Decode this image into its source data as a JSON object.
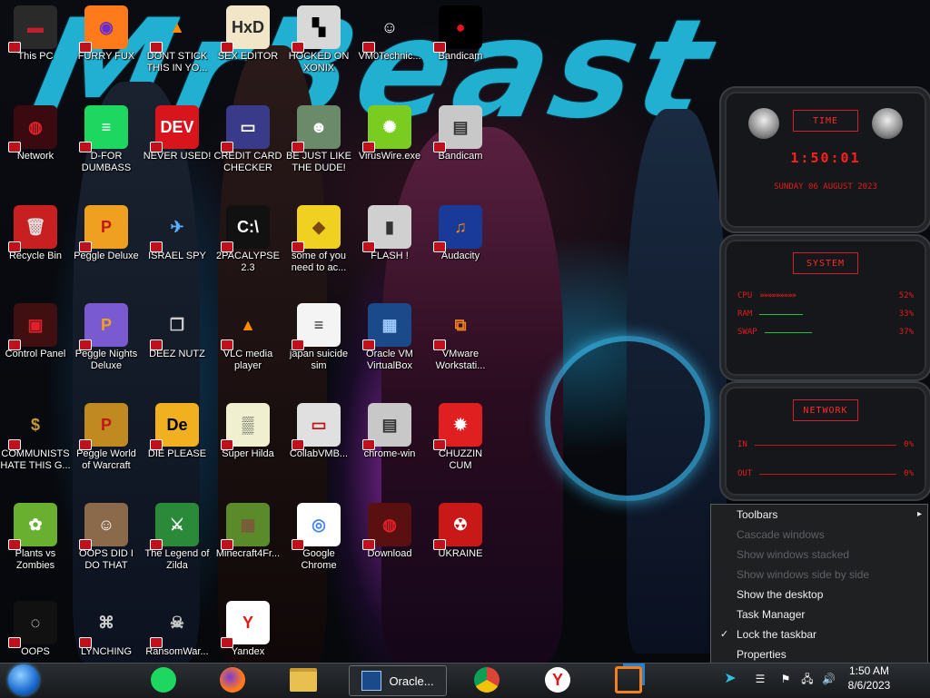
{
  "wallpaper": {
    "brand_text": "MrBeast"
  },
  "desktop_icons": [
    {
      "label": "This PC",
      "icon": "computer-icon",
      "bg": "#2a2a2a",
      "fg": "#c0202a",
      "glyph": "▬"
    },
    {
      "label": "FURRY FUX",
      "icon": "firefox-icon",
      "bg": "#ff7a1a",
      "fg": "#6a2cc8",
      "glyph": "◉"
    },
    {
      "label": "DONT STICK\nTHIS IN YO...",
      "icon": "vlc-cone-icon",
      "bg": "transparent",
      "fg": "#ff8c00",
      "glyph": "▲"
    },
    {
      "label": "SEX EDITOR",
      "icon": "hxd-icon",
      "bg": "#f2e6c8",
      "fg": "#2a2a2a",
      "glyph": "HxD"
    },
    {
      "label": "HOCKED ON\nXONIX",
      "icon": "xonix-icon",
      "bg": "#d8d8d8",
      "fg": "#000",
      "glyph": "▚"
    },
    {
      "label": "VM0Technic...",
      "icon": "doctor-icon",
      "bg": "transparent",
      "fg": "#fff",
      "glyph": "☺"
    },
    {
      "label": "Bandicam",
      "icon": "bandicam-record-icon",
      "bg": "#000",
      "fg": "#e3141c",
      "glyph": "●"
    },
    {
      "label": "Network",
      "icon": "network-icon",
      "bg": "#3a0a10",
      "fg": "#e0202a",
      "glyph": "◍"
    },
    {
      "label": "D-FOR\nDUMBASS",
      "icon": "spotify-icon",
      "bg": "#1ed760",
      "fg": "#fff",
      "glyph": "≡"
    },
    {
      "label": "NEVER USED!",
      "icon": "devcpp-icon",
      "bg": "#d8141c",
      "fg": "#fff",
      "glyph": "DEV"
    },
    {
      "label": "CREDIT CARD\nCHECKER",
      "icon": "credit-card-icon",
      "bg": "#3a3a8a",
      "fg": "#fff",
      "glyph": "▭"
    },
    {
      "label": "BE JUST LIKE\nTHE DUDE!",
      "icon": "dude-avatar-icon",
      "bg": "#6a8a6a",
      "fg": "#fff",
      "glyph": "☻"
    },
    {
      "label": "VirusWire.exe",
      "icon": "lime-icon",
      "bg": "#7acc20",
      "fg": "#fff",
      "glyph": "✺"
    },
    {
      "label": "Bandicam",
      "icon": "bandicam-folder-icon",
      "bg": "#c8c8c8",
      "fg": "#333",
      "glyph": "▤"
    },
    {
      "label": "Recycle Bin",
      "icon": "recycle-bin-icon",
      "bg": "#c82020",
      "fg": "#ddd",
      "glyph": "🗑"
    },
    {
      "label": "Peggle Deluxe",
      "icon": "peggle-icon",
      "bg": "#f0a020",
      "fg": "#c01818",
      "glyph": "P"
    },
    {
      "label": "ISRAEL SPY",
      "icon": "spy-tool-icon",
      "bg": "transparent",
      "fg": "#5ab0ff",
      "glyph": "✈"
    },
    {
      "label": "2PACALYPSE\n2.3",
      "icon": "terminal-icon",
      "bg": "#111",
      "fg": "#fff",
      "glyph": "C:\\"
    },
    {
      "label": "some of you\nneed to ac...",
      "icon": "beaver-icon",
      "bg": "#f0d020",
      "fg": "#7a4a10",
      "glyph": "◆"
    },
    {
      "label": "FLASH !",
      "icon": "flash-drive-icon",
      "bg": "#d0d0d0",
      "fg": "#333",
      "glyph": "▮"
    },
    {
      "label": "Audacity",
      "icon": "audacity-icon",
      "bg": "#1a3a9a",
      "fg": "#ff8800",
      "glyph": "♫"
    },
    {
      "label": "Control Panel",
      "icon": "control-panel-icon",
      "bg": "#401010",
      "fg": "#e0202a",
      "glyph": "▣"
    },
    {
      "label": "Peggle Nights\nDeluxe",
      "icon": "peggle-nights-icon",
      "bg": "#7a5ad0",
      "fg": "#f0a020",
      "glyph": "P"
    },
    {
      "label": "DEEZ NUTZ",
      "icon": "stacked-windows-icon",
      "bg": "transparent",
      "fg": "#ccc",
      "glyph": "❒"
    },
    {
      "label": "VLC media\nplayer",
      "icon": "vlc-icon",
      "bg": "transparent",
      "fg": "#ff8c00",
      "glyph": "▲"
    },
    {
      "label": "japan suicide\nsim",
      "icon": "document-icon",
      "bg": "#f4f4f4",
      "fg": "#333",
      "glyph": "≡"
    },
    {
      "label": "Oracle VM\nVirtualBox",
      "icon": "virtualbox-icon",
      "bg": "#1b4a8a",
      "fg": "#9ecbff",
      "glyph": "▦"
    },
    {
      "label": "VMware\nWorkstati...",
      "icon": "vmware-icon",
      "bg": "transparent",
      "fg": "#f08020",
      "glyph": "⧉"
    },
    {
      "label": "COMMUNISTS\nHATE THIS G...",
      "icon": "money-bag-icon",
      "bg": "transparent",
      "fg": "#c89a3a",
      "glyph": "$"
    },
    {
      "label": "Peggle World\nof Warcraft",
      "icon": "peggle-wow-icon",
      "bg": "#c08a20",
      "fg": "#c01818",
      "glyph": "P"
    },
    {
      "label": "DIE PLEASE",
      "icon": "die-icon",
      "bg": "#f0b020",
      "fg": "#000",
      "glyph": "De"
    },
    {
      "label": "Super Hilda",
      "icon": "pixel-hilda-icon",
      "bg": "#f0f0d0",
      "fg": "#333",
      "glyph": "▒"
    },
    {
      "label": "CollabVMB...",
      "icon": "monitor-icon",
      "bg": "#e0e0e0",
      "fg": "#c01818",
      "glyph": "▭"
    },
    {
      "label": "chrome-win",
      "icon": "folder-icon",
      "bg": "#c8c8c8",
      "fg": "#333",
      "glyph": "▤"
    },
    {
      "label": "CHUZZIN\nCUM",
      "icon": "chuzzle-icon",
      "bg": "#e02020",
      "fg": "#fff",
      "glyph": "✹"
    },
    {
      "label": "Plants vs\nZombies",
      "icon": "pvz-icon",
      "bg": "#6ab030",
      "fg": "#fff",
      "glyph": "✿"
    },
    {
      "label": "OOPS DID I\nDO THAT",
      "icon": "portrait-icon",
      "bg": "#8a6a4a",
      "fg": "#fff",
      "glyph": "☺"
    },
    {
      "label": "The Legend of\nZilda",
      "icon": "zilda-sprite-icon",
      "bg": "#2a8a3a",
      "fg": "#fff",
      "glyph": "⚔"
    },
    {
      "label": "Minecraft4Fr...",
      "icon": "minecraft-block-icon",
      "bg": "#5a8a2a",
      "fg": "#7a5a3a",
      "glyph": "▦"
    },
    {
      "label": "Google\nChrome",
      "icon": "chrome-icon",
      "bg": "#ffffff",
      "fg": "#4285f4",
      "glyph": "◎"
    },
    {
      "label": "Download",
      "icon": "download-icon",
      "bg": "#5a1010",
      "fg": "#e0202a",
      "glyph": "◍"
    },
    {
      "label": "UKRAINE",
      "icon": "radiation-icon",
      "bg": "#c81818",
      "fg": "#fff",
      "glyph": "☢"
    },
    {
      "label": "OOPS",
      "icon": "oops-icon",
      "bg": "#111",
      "fg": "#fff",
      "glyph": "◌"
    },
    {
      "label": "LYNCHING",
      "icon": "rope-icon",
      "bg": "transparent",
      "fg": "#ccc",
      "glyph": "⌘"
    },
    {
      "label": "RansomWar...",
      "icon": "skull-icon",
      "bg": "transparent",
      "fg": "#ccc",
      "glyph": "☠"
    },
    {
      "label": "Yandex",
      "icon": "yandex-icon",
      "bg": "#ffffff",
      "fg": "#e01818",
      "glyph": "Y"
    }
  ],
  "widgets": {
    "time": {
      "title": "TIME",
      "clock": "1:50:01",
      "date": "SUNDAY 06 AUGUST 2023"
    },
    "system": {
      "title": "SYSTEM",
      "rows": [
        {
          "label": "CPU",
          "value": "52%",
          "level": 0.52
        },
        {
          "label": "RAM",
          "value": "33%",
          "level": 0.33
        },
        {
          "label": "SWAP",
          "value": "37%",
          "level": 0.37
        }
      ]
    },
    "network": {
      "title": "NETWORK",
      "rows": [
        {
          "label": "IN",
          "value": "0%"
        },
        {
          "label": "OUT",
          "value": "0%"
        }
      ]
    }
  },
  "context_menu": {
    "items": [
      {
        "label": "Toolbars",
        "enabled": true,
        "submenu": true,
        "checked": false
      },
      {
        "label": "Cascade windows",
        "enabled": false,
        "submenu": false,
        "checked": false
      },
      {
        "label": "Show windows stacked",
        "enabled": false,
        "submenu": false,
        "checked": false
      },
      {
        "label": "Show windows side by side",
        "enabled": false,
        "submenu": false,
        "checked": false
      },
      {
        "label": "Show the desktop",
        "enabled": true,
        "submenu": false,
        "checked": false
      },
      {
        "label": "Task Manager",
        "enabled": true,
        "submenu": false,
        "checked": false
      },
      {
        "label": "Lock the taskbar",
        "enabled": true,
        "submenu": false,
        "checked": true
      },
      {
        "label": "Properties",
        "enabled": true,
        "submenu": false,
        "checked": false
      }
    ]
  },
  "taskbar": {
    "start": "start-orb-icon",
    "pinned": [
      {
        "icon": "spotify-icon",
        "color": "#1ed760"
      },
      {
        "icon": "firefox-icon",
        "color": "#ff7a1a"
      },
      {
        "icon": "file-explorer-icon",
        "color": "#e8c050"
      }
    ],
    "active_app": {
      "label": "Oracle...",
      "icon": "virtualbox-icon"
    },
    "pinned_right": [
      {
        "icon": "chrome-icon",
        "color": "#ffffff"
      },
      {
        "icon": "yandex-icon",
        "color": "#ffffff"
      },
      {
        "icon": "vmware-icon",
        "color": "#f08020"
      }
    ],
    "clock": {
      "time": "1:50 AM",
      "date": "8/6/2023"
    }
  }
}
